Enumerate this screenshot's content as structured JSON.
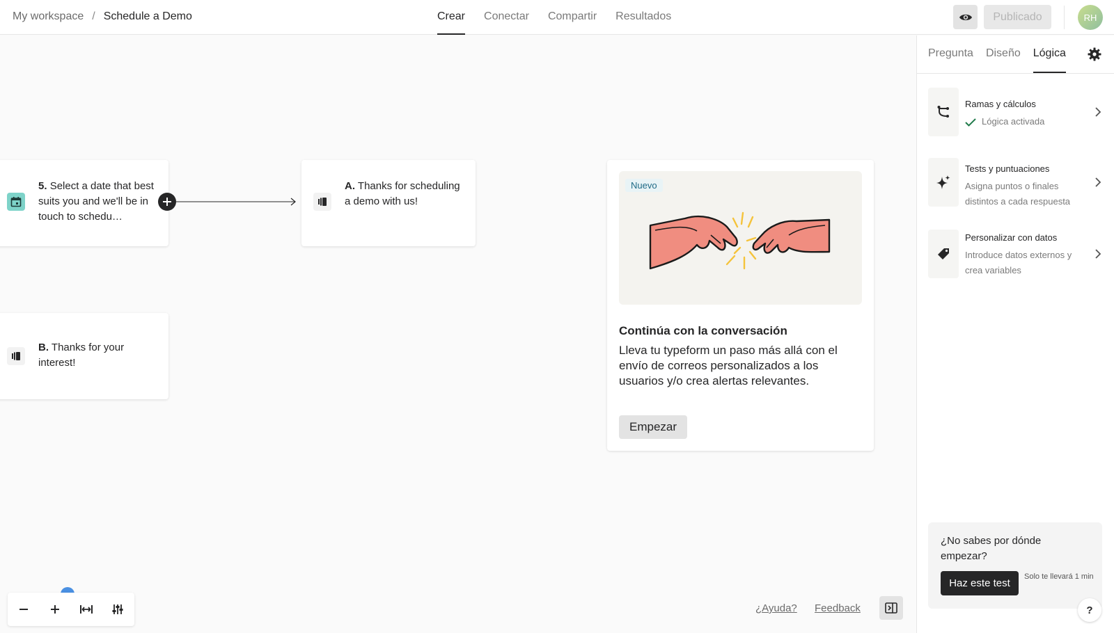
{
  "breadcrumb": {
    "workspace": "My workspace",
    "separator": "/",
    "current": "Schedule a Demo"
  },
  "nav": {
    "tabs": [
      {
        "label": "Crear",
        "active": true
      },
      {
        "label": "Conectar",
        "active": false
      },
      {
        "label": "Compartir",
        "active": false
      },
      {
        "label": "Resultados",
        "active": false
      }
    ]
  },
  "header": {
    "publish_label": "Publicado",
    "avatar_initials": "RH"
  },
  "canvas": {
    "nodes": [
      {
        "num": "5.",
        "text": "Select a date that best suits you and we'll be in touch to schedu…",
        "icon": "calendar-icon",
        "icon_color": "#7ed3c9"
      },
      {
        "num": "A.",
        "text": "Thanks for scheduling a demo with us!",
        "icon": "ending-icon"
      },
      {
        "num": "B.",
        "text": "Thanks for your interest!",
        "icon": "ending-icon"
      }
    ],
    "promo": {
      "badge": "Nuevo",
      "title": "Continúa con la conversación",
      "description": "Lleva tu typeform un paso más allá con el envío de correos personalizados a los usuarios y/o crea alertas relevantes.",
      "button": "Empezar"
    },
    "help_link": "¿Ayuda?",
    "feedback_link": "Feedback"
  },
  "panel": {
    "tabs": [
      {
        "label": "Pregunta",
        "active": false
      },
      {
        "label": "Diseño",
        "active": false
      },
      {
        "label": "Lógica",
        "active": true
      }
    ],
    "items": [
      {
        "title": "Ramas y cálculos",
        "subtitle": "Lógica activada",
        "icon": "branch-icon",
        "enabled": true
      },
      {
        "title": "Tests y puntuaciones",
        "subtitle": "Asigna puntos o finales distintos a cada respuesta",
        "icon": "sparkle-icon"
      },
      {
        "title": "Personalizar con datos",
        "subtitle": "Introduce datos externos y crea variables",
        "icon": "tag-icon"
      }
    ],
    "help_card": {
      "title": "¿No sabes por dónde empezar?",
      "button": "Haz este test",
      "note": "Solo te llevará 1 min"
    },
    "question_label": "?"
  },
  "colors": {
    "accent_dark": "#262627",
    "badge_bg": "#e8f3f6",
    "badge_text": "#1f6a86",
    "hand_fill": "#f08d80",
    "spark": "#f5c33b"
  }
}
